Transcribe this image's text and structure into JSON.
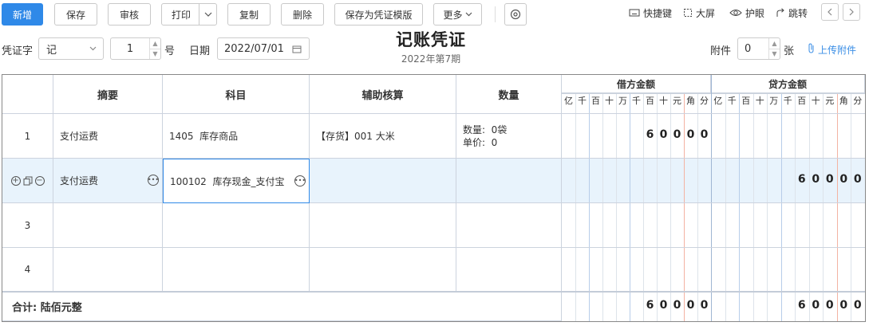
{
  "toolbar": {
    "new": "新增",
    "save": "保存",
    "audit": "审核",
    "print": "打印",
    "copy": "复制",
    "delete": "删除",
    "save_template": "保存为凭证模版",
    "more": "更多",
    "shortcut": "快捷键",
    "fullscreen": "大屏",
    "eye_care": "护眼",
    "jump": "跳转"
  },
  "header": {
    "voucher_word_label": "凭证字",
    "voucher_word": "记",
    "voucher_no": "1",
    "no_unit": "号",
    "date_label": "日期",
    "date": "2022/07/01",
    "title": "记账凭证",
    "period": "2022年第7期",
    "attach_label": "附件",
    "attach_count": "0",
    "attach_unit": "张",
    "upload": "上传附件"
  },
  "table": {
    "headers": {
      "summary": "摘要",
      "account": "科目",
      "aux": "辅助核算",
      "qty": "数量",
      "debit": "借方金额",
      "credit": "贷方金额"
    },
    "digits": [
      "亿",
      "千",
      "百",
      "十",
      "万",
      "千",
      "百",
      "十",
      "元",
      "角",
      "分"
    ],
    "rows": [
      {
        "no": "1",
        "summary": "支付运费",
        "account": "1405  库存商品",
        "aux": "【存货】001 大米",
        "qty_line1": "数量:  0袋",
        "qty_line2": "单价:  0",
        "debit": "60000",
        "credit": ""
      },
      {
        "no": "",
        "summary": "支付运费",
        "account": "100102  库存现金_支付宝",
        "aux": "",
        "qty_line1": "",
        "qty_line2": "",
        "debit": "",
        "credit": "60000"
      },
      {
        "no": "3",
        "summary": "",
        "account": "",
        "aux": "",
        "qty_line1": "",
        "qty_line2": "",
        "debit": "",
        "credit": ""
      },
      {
        "no": "4",
        "summary": "",
        "account": "",
        "aux": "",
        "qty_line1": "",
        "qty_line2": "",
        "debit": "",
        "credit": ""
      }
    ],
    "total_label": "合计: 陆佰元整",
    "total_debit": "60000",
    "total_credit": "60000"
  }
}
